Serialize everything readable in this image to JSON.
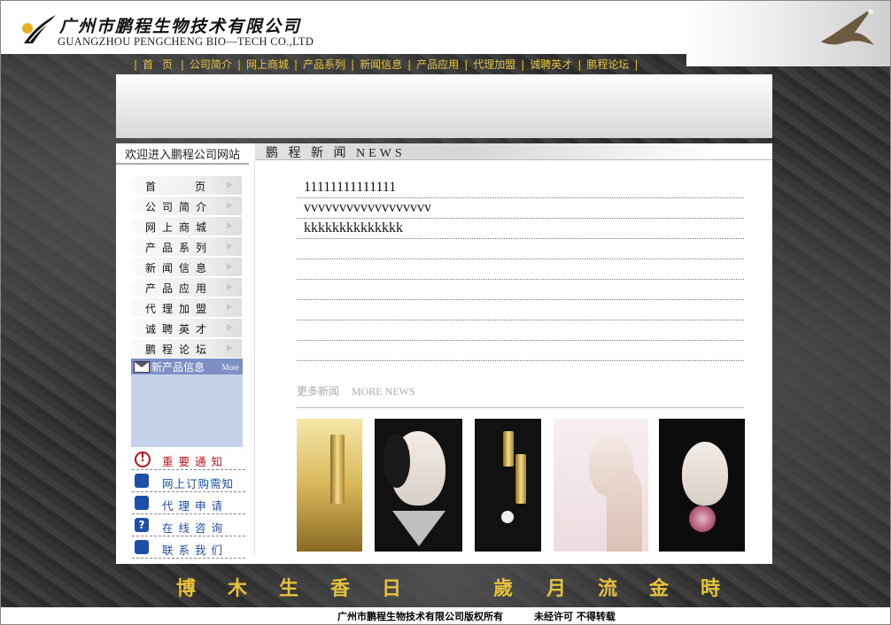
{
  "header": {
    "company_cn": "广州市鹏程生物技术有限公司",
    "company_en": "GUANGZHOU PENGCHENG BIO—TECH CO.,LTD"
  },
  "nav": {
    "items": [
      "首 页",
      "公司简介",
      "网上商城",
      "产品系列",
      "新闻信息",
      "产品应用",
      "代理加盟",
      "诚聘英才",
      "鹏程论坛"
    ]
  },
  "sidebar": {
    "welcome": "欢迎进入鹏程公司网站",
    "menu": [
      "首　　　页",
      "公司简介",
      "网上商城",
      "产品系列",
      "新闻信息",
      "产品应用",
      "代理加盟",
      "诚聘英才",
      "鹏程论坛"
    ],
    "new_products": {
      "title": "新产品信息",
      "more": "More"
    },
    "quick_links": [
      "重要通知",
      "网上订购需知",
      "代理申请",
      "在线咨询",
      "联系我们"
    ]
  },
  "news": {
    "header": "鹏 程 新 闻 NEWS",
    "items": [
      "11111111111111",
      "vvvvvvvvvvvvvvvvvv",
      "kkkkkkkkkkkkkk",
      "",
      "",
      "",
      "",
      "",
      ""
    ],
    "more_cn": "更多新闻",
    "more_en": "MORE NEWS"
  },
  "footer": {
    "slogan": [
      "博",
      "木",
      "生",
      "香",
      "日",
      "歲",
      "月",
      "流",
      "金",
      "時"
    ],
    "copyright": "广州市鹏程生物技术有限公司版权所有",
    "notice": "未经许可  不得转载"
  },
  "colors": {
    "nav_text": "#e8c640",
    "link_blue": "#1d4ea8",
    "alert_red": "#c0121a"
  }
}
